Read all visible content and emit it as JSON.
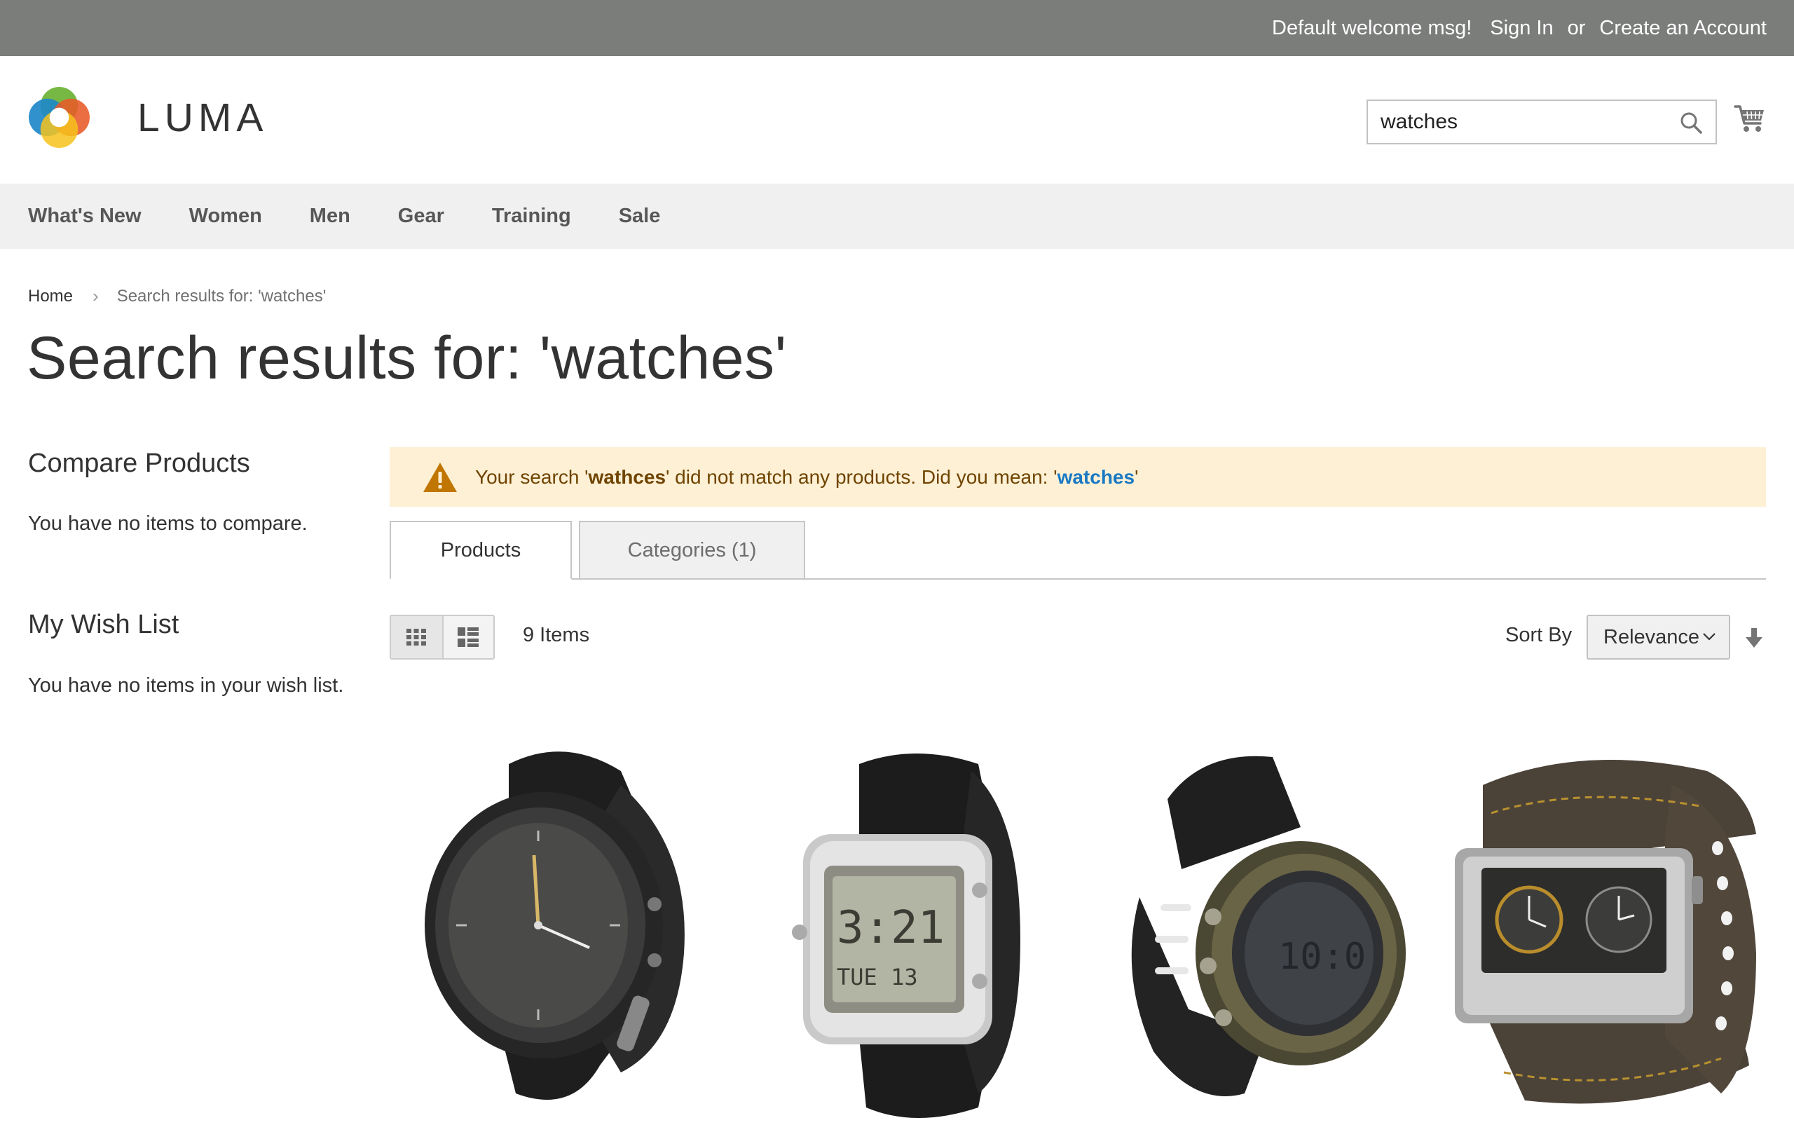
{
  "topbar": {
    "welcome": "Default welcome msg!",
    "sign_in": "Sign In",
    "or": "or",
    "create_account": "Create an Account"
  },
  "header": {
    "logo_text": "LUMA",
    "search_value": "watches"
  },
  "nav": {
    "items": [
      "What's New",
      "Women",
      "Men",
      "Gear",
      "Training",
      "Sale"
    ]
  },
  "breadcrumb": {
    "home": "Home",
    "current": "Search results for: 'watches'"
  },
  "page_title": "Search results for: 'watches'",
  "sidebar": {
    "compare_title": "Compare Products",
    "compare_text": "You have no items to compare.",
    "wishlist_title": "My Wish List",
    "wishlist_text": "You have no items in your wish list."
  },
  "notice": {
    "prefix": "Your search '",
    "query": "wathces",
    "middle": "' did not match any products. Did you mean:  '",
    "suggestion": "watches",
    "suffix": "'"
  },
  "tabs": {
    "products": "Products",
    "categories": "Categories (1)"
  },
  "toolbar": {
    "items_count": "9 Items",
    "sort_label": "Sort By",
    "sort_value": "Relevance"
  },
  "products": [
    {
      "image": "black-analog-sport-watch"
    },
    {
      "image": "silver-digital-watch"
    },
    {
      "image": "olive-bezel-digital-watch"
    },
    {
      "image": "leather-dual-time-watch"
    }
  ],
  "colors": {
    "topbar_bg": "#7b7d7b",
    "nav_bg": "#f0f0f0",
    "notice_bg": "#fdf0d5",
    "notice_text": "#6f4400",
    "link": "#1979c3",
    "warning": "#c07600"
  }
}
